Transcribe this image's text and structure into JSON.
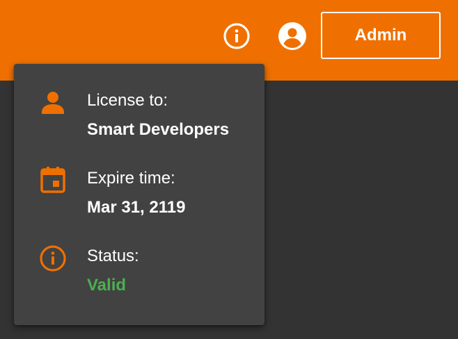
{
  "header": {
    "info_icon": "info-circle-icon",
    "account_icon": "account-circle-icon",
    "admin_label": "Admin"
  },
  "license_popup": {
    "license": {
      "icon": "person-icon",
      "label": "License to:",
      "value": "Smart Developers"
    },
    "expire": {
      "icon": "calendar-icon",
      "label": "Expire time:",
      "value": "Mar 31, 2119"
    },
    "status": {
      "icon": "info-circle-icon",
      "label": "Status:",
      "value": "Valid"
    }
  },
  "colors": {
    "header": "#ef7000",
    "accent_icon": "#ef7000",
    "background": "#333333",
    "popup": "#424242",
    "valid": "#4caf50"
  }
}
